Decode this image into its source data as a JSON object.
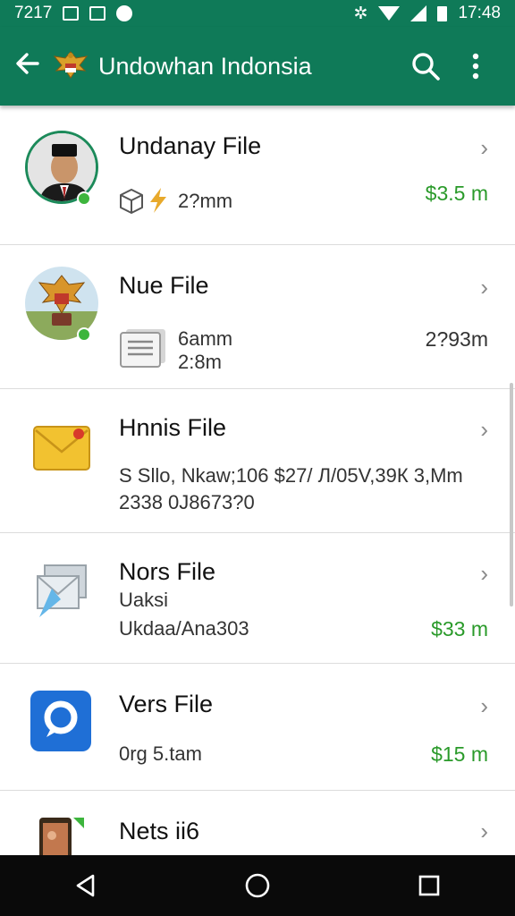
{
  "status_bar": {
    "time_left": "7217",
    "time_right": "17:48"
  },
  "app_bar": {
    "title": "Undowhan Indonsia",
    "icons": [
      "back-arrow-icon",
      "emblem-logo",
      "search-icon",
      "more-vert-icon"
    ],
    "color": "#0f7a58"
  },
  "files": [
    {
      "name": "Undanay File",
      "line1": "2?mm",
      "line2": "",
      "right_value": "$3.5 m",
      "right_color": "green",
      "icon": "portrait-avatar"
    },
    {
      "name": "Nue File",
      "line1": "6amm",
      "line2": "2:8m",
      "right_value": "2?93m",
      "right_color": "grey",
      "icon": "garuda-emblem-avatar"
    },
    {
      "name": "Hnnis File",
      "line1": "S Sllo, Nkaw;106 $27/ Л/05V,39К 3,Mm",
      "line2": "2338 0J8673?0",
      "right_value": "",
      "right_color": "grey",
      "icon": "envelope-icon"
    },
    {
      "name": "Nors File",
      "line1": "Uaksi",
      "line2": "Ukdaa/Ana303",
      "right_value": "$33 m",
      "right_color": "green",
      "icon": "mail-stack-icon"
    },
    {
      "name": "Vers File",
      "line1": "",
      "line2": "0rg 5.tam",
      "right_value": "$15 m",
      "right_color": "green",
      "icon": "chat-bubble-icon"
    },
    {
      "name": "Nets ii6",
      "line1": "",
      "line2": "",
      "right_value": "",
      "right_color": "grey",
      "icon": "phone-photo-icon"
    }
  ],
  "nav_bar": {
    "icons": [
      "back-triangle-icon",
      "home-circle-icon",
      "recents-square-icon"
    ]
  }
}
